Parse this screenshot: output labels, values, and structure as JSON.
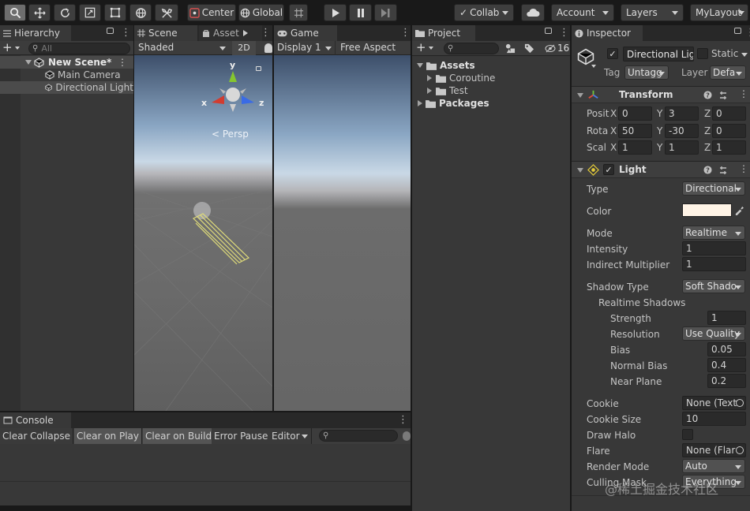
{
  "toolbar": {
    "center_label": "Center",
    "global_label": "Global",
    "collab_label": "Collab",
    "account_label": "Account",
    "layers_label": "Layers",
    "layout_label": "MyLayout"
  },
  "hierarchy": {
    "tab": "Hierarchy",
    "search_placeholder": "All",
    "scene_name": "New Scene*",
    "items": [
      {
        "label": "Main Camera"
      },
      {
        "label": "Directional Light"
      }
    ]
  },
  "scene": {
    "tab": "Scene",
    "tab2": "Asset S",
    "shading": "Shaded",
    "mode2d": "2D",
    "gizmo": {
      "y": "y",
      "x": "x",
      "z": "z",
      "persp": "Persp"
    }
  },
  "game": {
    "tab": "Game",
    "display": "Display 1",
    "aspect": "Free Aspect"
  },
  "project": {
    "tab": "Project",
    "hidden_count": "16",
    "tree": [
      {
        "label": "Assets"
      },
      {
        "label": "Coroutine"
      },
      {
        "label": "Test"
      },
      {
        "label": "Packages"
      }
    ]
  },
  "console": {
    "tab": "Console",
    "buttons": [
      "Clear",
      "Collapse",
      "Clear on Play",
      "Clear on Build",
      "Error Pause",
      "Editor"
    ]
  },
  "inspector": {
    "tab": "Inspector",
    "object_name": "Directional Lig",
    "static_label": "Static",
    "tag_label": "Tag",
    "tag_value": "Untagg",
    "layer_label": "Layer",
    "layer_value": "Defa",
    "transform": {
      "title": "Transform",
      "position_label": "Posit",
      "rotation_label": "Rota",
      "scale_label": "Scal",
      "position": [
        "0",
        "3",
        "0"
      ],
      "rotation": [
        "50",
        "-30",
        "0"
      ],
      "scale": [
        "1",
        "1",
        "1"
      ],
      "axis_x": "X",
      "axis_y": "Y",
      "axis_z": "Z"
    },
    "light": {
      "title": "Light",
      "color_swatch": "#fff4e6",
      "props": [
        {
          "label": "Type",
          "value": "Directional"
        },
        {
          "label": "Color",
          "value": ""
        },
        {
          "label": "Mode",
          "value": "Realtime"
        },
        {
          "label": "Intensity",
          "value": "1"
        },
        {
          "label": "Indirect Multiplier",
          "value": "1"
        },
        {
          "label": "Shadow Type",
          "value": "Soft Shado"
        },
        {
          "label": "Realtime Shadows",
          "value": ""
        },
        {
          "label": "Strength",
          "value": "1"
        },
        {
          "label": "Resolution",
          "value": "Use Quality"
        },
        {
          "label": "Bias",
          "value": "0.05"
        },
        {
          "label": "Normal Bias",
          "value": "0.4"
        },
        {
          "label": "Near Plane",
          "value": "0.2"
        },
        {
          "label": "Cookie",
          "value": "None (Text"
        },
        {
          "label": "Cookie Size",
          "value": "10"
        },
        {
          "label": "Draw Halo",
          "value": ""
        },
        {
          "label": "Flare",
          "value": "None (Flar"
        },
        {
          "label": "Render Mode",
          "value": "Auto"
        },
        {
          "label": "Culling Mask",
          "value": "Everything"
        }
      ]
    }
  },
  "watermark": "@稀土掘金技术社区"
}
